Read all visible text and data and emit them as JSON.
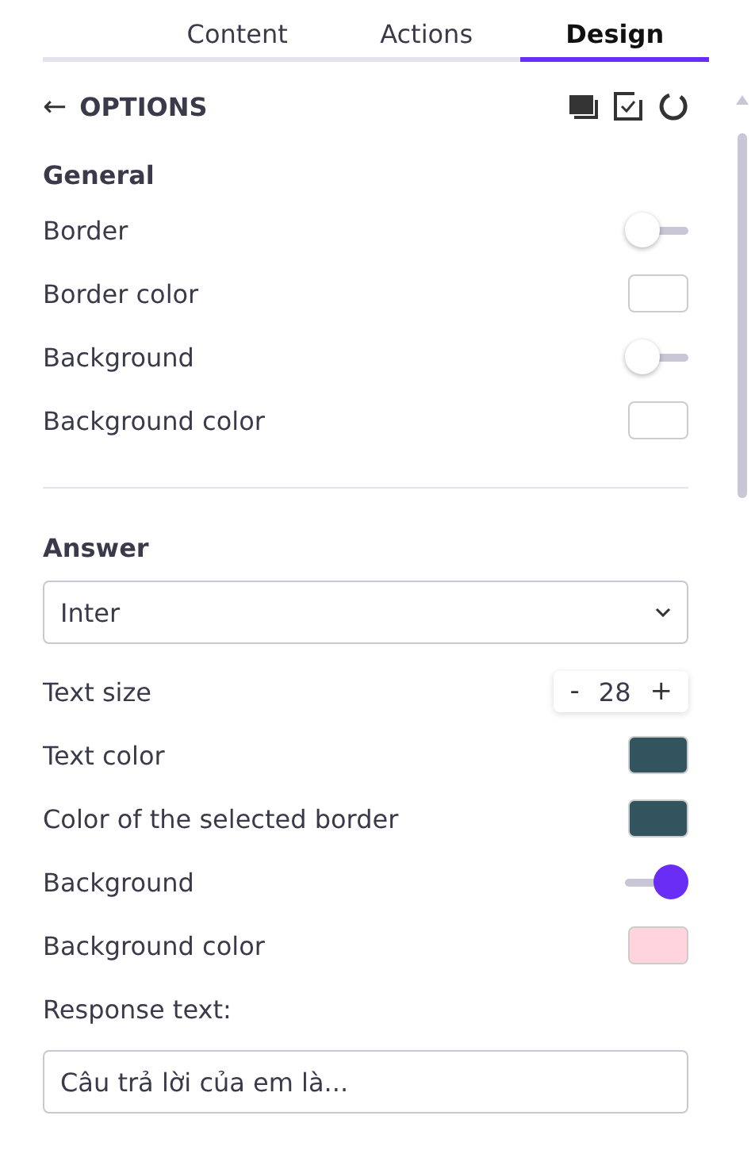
{
  "tabs": [
    {
      "label": "Content",
      "selected": false
    },
    {
      "label": "Actions",
      "selected": false
    },
    {
      "label": "Design",
      "selected": true
    }
  ],
  "header": {
    "back": "←",
    "title": "OPTIONS"
  },
  "sections": [
    {
      "title": "General",
      "rows": [
        {
          "kind": "toggle",
          "label": "Border",
          "on": false
        },
        {
          "kind": "swatch",
          "label": "Border color",
          "color": "#ffffff"
        },
        {
          "kind": "toggle",
          "label": "Background",
          "on": false
        },
        {
          "kind": "swatch",
          "label": "Background color",
          "color": "#ffffff"
        }
      ]
    },
    {
      "title": "Answer",
      "rows": [
        {
          "kind": "select",
          "value": "Inter"
        },
        {
          "kind": "stepper",
          "label": "Text size",
          "minus": "-",
          "value": "28",
          "plus": "+"
        },
        {
          "kind": "swatch",
          "label": "Text color",
          "color": "#32545e"
        },
        {
          "kind": "swatch",
          "label": "Color of the selected border",
          "color": "#32545e"
        },
        {
          "kind": "toggle",
          "label": "Background",
          "on": true
        },
        {
          "kind": "swatch",
          "label": "Background color",
          "color": "#ffd4dd"
        },
        {
          "kind": "caption",
          "label": "Response text:"
        },
        {
          "kind": "field",
          "placeholder": "Câu trả lời của em là..."
        }
      ]
    }
  ]
}
